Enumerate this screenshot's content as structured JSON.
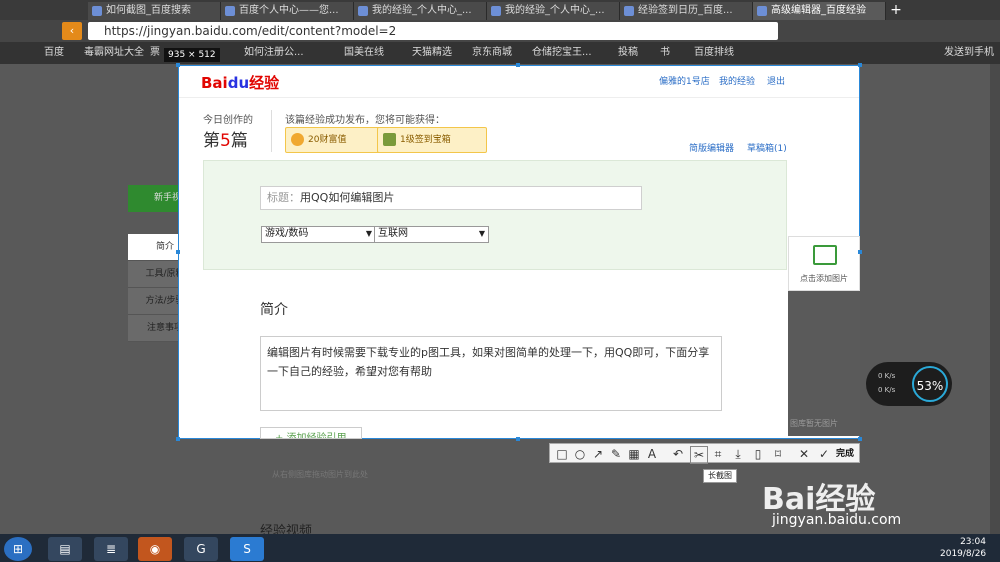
{
  "browser": {
    "tabs": [
      {
        "label": "如何截图_百度搜索"
      },
      {
        "label": "百度个人中心——您..."
      },
      {
        "label": "我的经验_个人中心_..."
      },
      {
        "label": "我的经验_个人中心_..."
      },
      {
        "label": "经验签到日历_百度..."
      },
      {
        "label": "高级编辑器_百度经验"
      }
    ],
    "url": "https://jingyan.baidu.com/edit/content?model=2",
    "bookmarks": [
      "百度",
      "毒霸网址大全",
      "票",
      "如何注册公...",
      "国美在线",
      "天猫精选",
      "京东商城",
      "仓储挖宝王...",
      "投稿",
      "书",
      "百度排线",
      "发送到手机"
    ]
  },
  "capture": {
    "size_label": "935 × 512",
    "logo_bai": "Bai",
    "logo_du": "du",
    "logo_jy": "经验",
    "top_links": [
      "偏雅的1号店",
      "我的经验",
      "退出"
    ],
    "today_label": "今日创作的",
    "count_prefix": "第",
    "count_num": "5",
    "count_suffix": "篇",
    "promo": "该篇经验成功发布，您将可能获得：",
    "badge1": "20财富值",
    "badge2": "1级签到宝箱",
    "classic_editor": "简版编辑器",
    "drafts": "草稿箱(1)",
    "title_placeholder": "标题：",
    "title_value": "用QQ如何编辑图片",
    "category1": "游戏/数码",
    "category2": "互联网",
    "intro_heading": "简介",
    "intro_text": "编辑图片有时候需要下载专业的p图工具，如果对图简单的处理一下，用QQ即可，下面分享一下自己的经验，希望对您有帮助",
    "add_ref": "+ 添加经验引用"
  },
  "side": {
    "add_image": "点击添加图片",
    "no_image": "图库暂无图片",
    "new_video": "新手视频",
    "nav": [
      "简介",
      "工具/原料",
      "方法/步骤",
      "注意事项"
    ]
  },
  "below": {
    "drag_note": "从右侧图库拖动图片到此处",
    "video_heading": "经验视频"
  },
  "toolbar": {
    "done": "完成",
    "tooltip": "长截图"
  },
  "netmeter": {
    "up": "0 K/s",
    "down": "0 K/s",
    "percent": "53%"
  },
  "watermark": {
    "line1": "Bai经验",
    "line2": "jingyan.baidu.com"
  },
  "taskbar": {
    "time": "23:04",
    "date": "2019/8/26"
  }
}
